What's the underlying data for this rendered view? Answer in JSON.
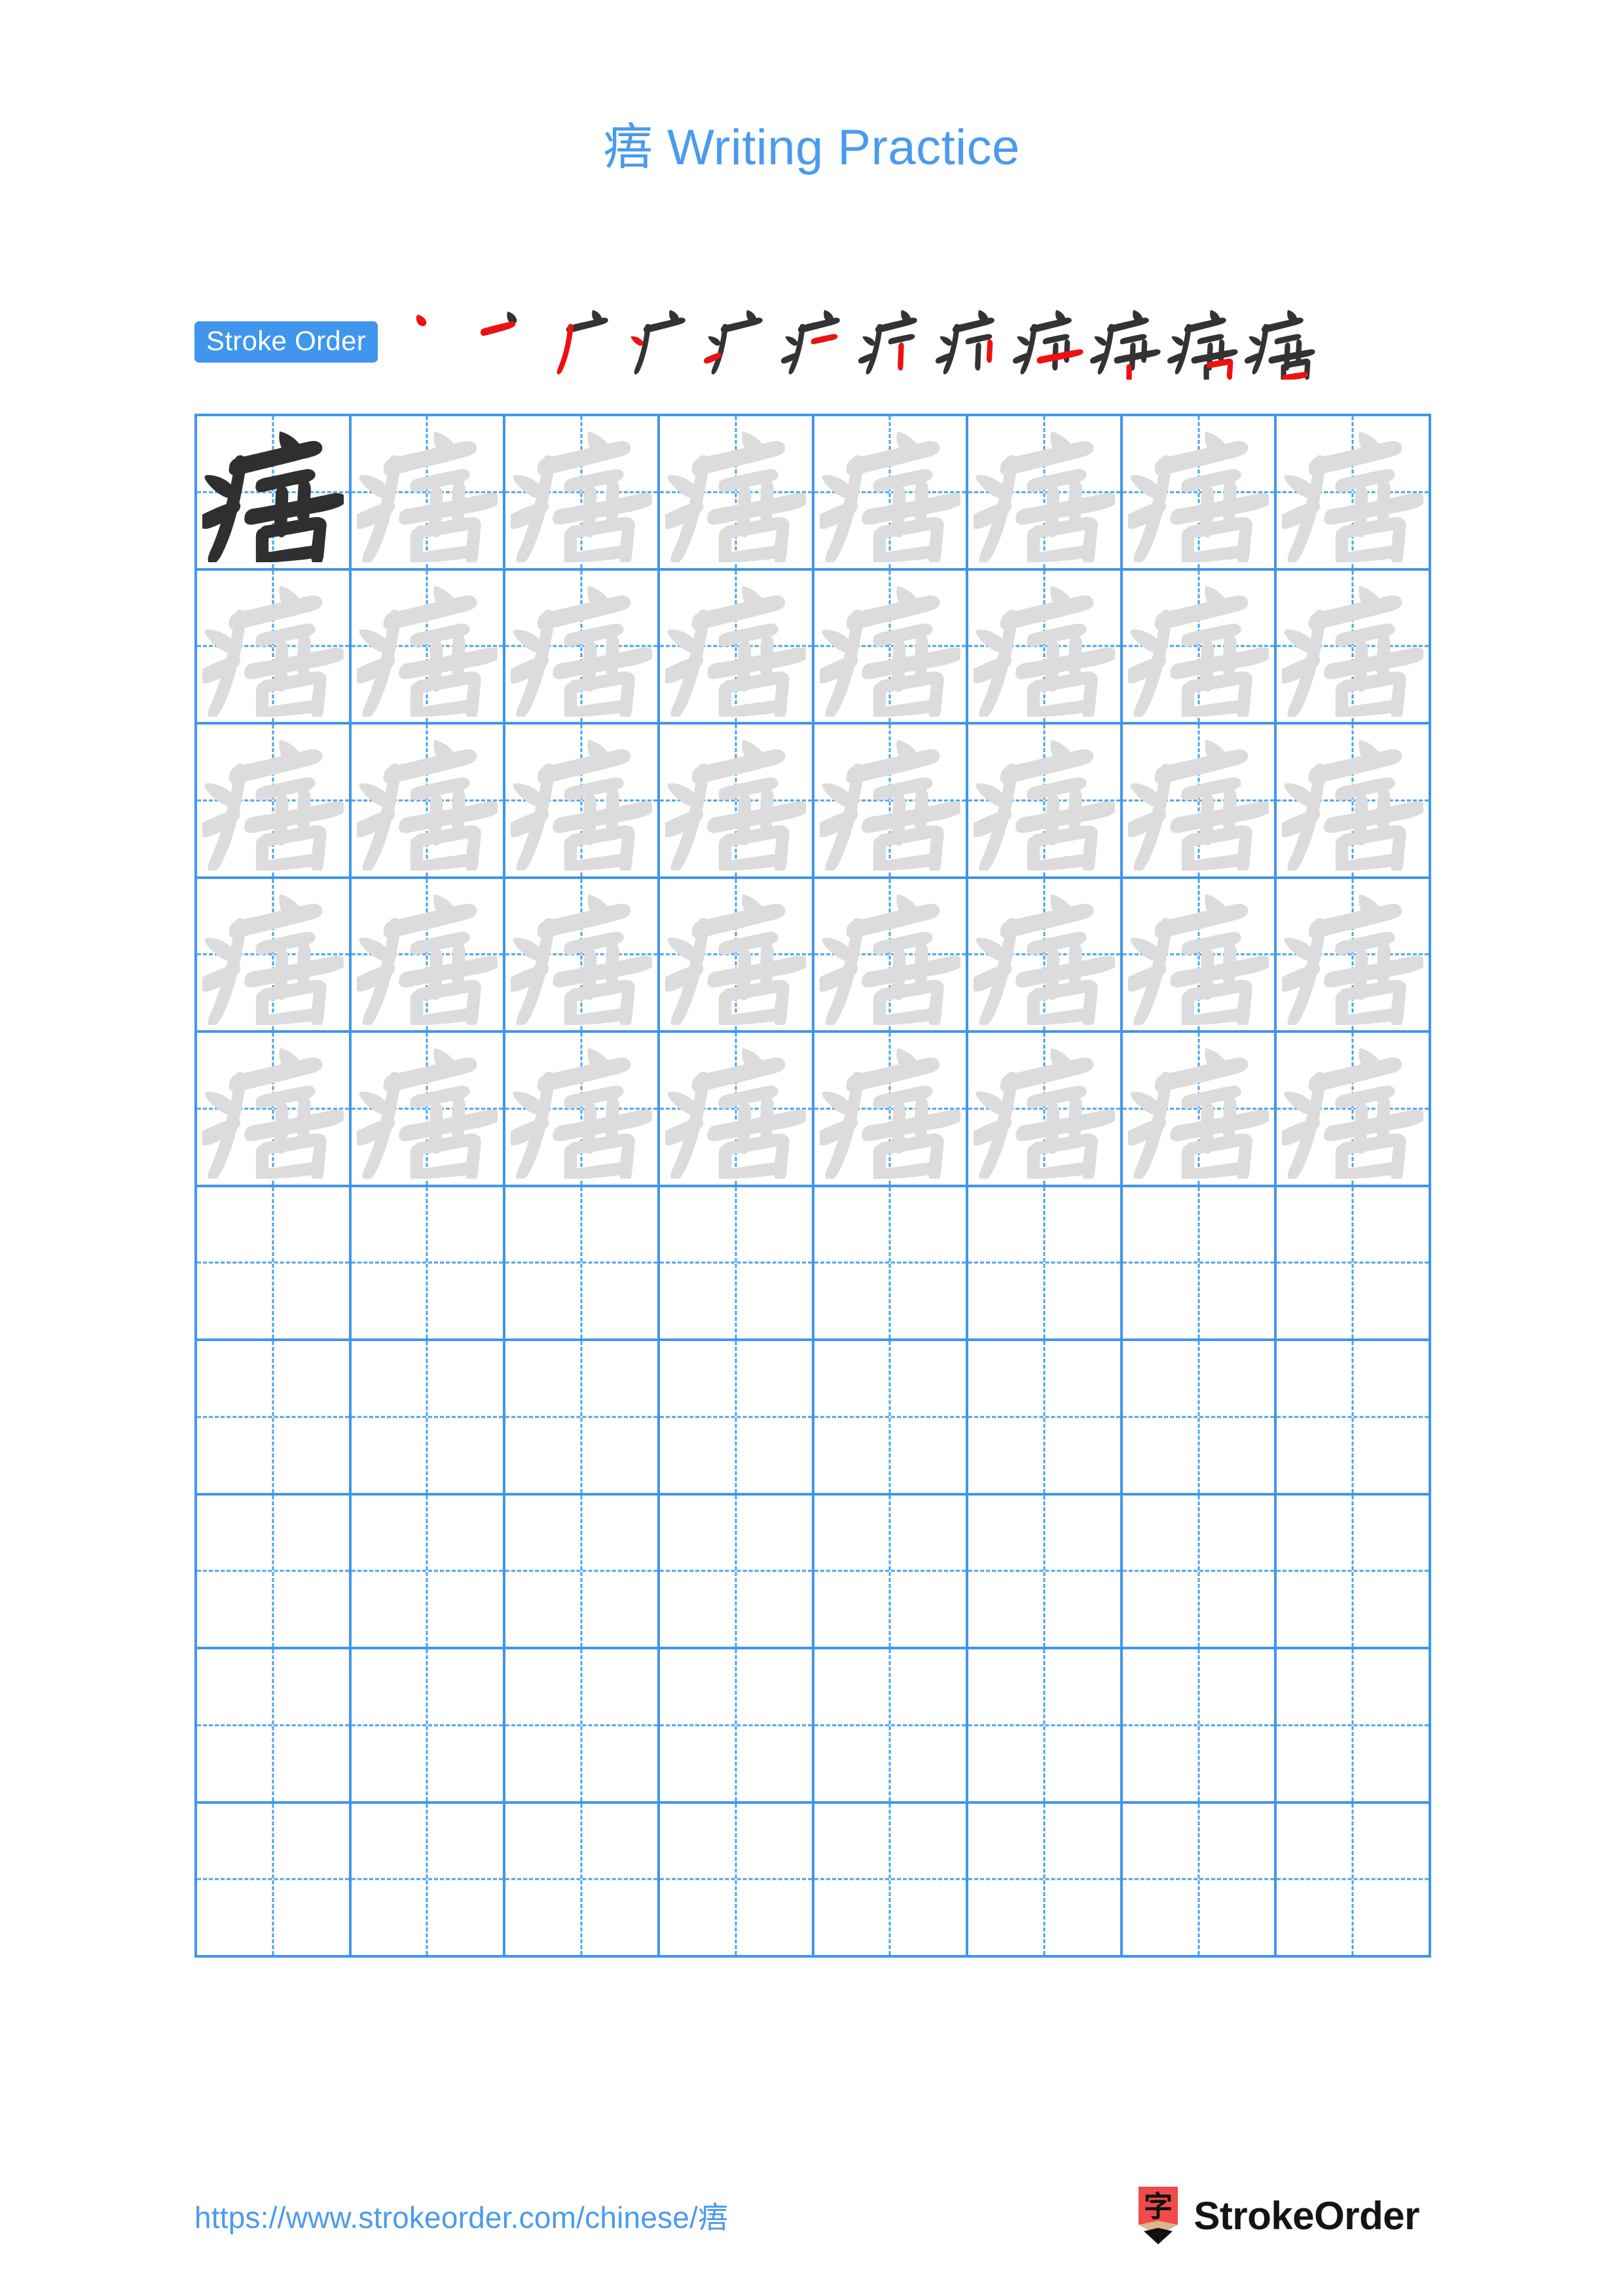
{
  "document": {
    "character": "痦",
    "title": "痦 Writing Practice",
    "page_background": "#ffffff"
  },
  "header": {
    "title": "痦 Writing Practice",
    "title_color": "#4a9bee"
  },
  "stroke_order": {
    "badge_label": "Stroke Order",
    "badge_background": "#3f96ec",
    "badge_text_color": "#ffffff",
    "stroke_count": 12,
    "new_stroke_color": "#ee1111",
    "existing_stroke_color": "#333333",
    "steps": [
      {
        "index": 1,
        "glyph": "丶",
        "description": "dot"
      },
      {
        "index": 2,
        "glyph": "亠",
        "description": "horizontal"
      },
      {
        "index": 3,
        "glyph": "广",
        "description": "left-falling stroke"
      },
      {
        "index": 4,
        "glyph": "广",
        "description": "dot of sickness radical"
      },
      {
        "index": 5,
        "glyph": "疒",
        "description": "left dot"
      },
      {
        "index": 6,
        "glyph": "疒",
        "description": "upper right short stroke"
      },
      {
        "index": 7,
        "glyph": "疒",
        "description": "vertical"
      },
      {
        "index": 8,
        "glyph": "疖",
        "description": "short vertical of 吾"
      },
      {
        "index": 9,
        "glyph": "疘",
        "description": "horizontal of 五"
      },
      {
        "index": 10,
        "glyph": "痦",
        "description": "vertical of mouth"
      },
      {
        "index": 11,
        "glyph": "痦",
        "description": "horizontal-fold of mouth"
      },
      {
        "index": 12,
        "glyph": "痦",
        "description": "closing horizontal"
      }
    ]
  },
  "practice_grid": {
    "columns": 8,
    "rows": 10,
    "border_color": "#3f96ec",
    "guide_color": "#4aa3f0",
    "dark_glyph_color": "#2f2f2f",
    "light_glyph_color": "#dcdcdc",
    "cells": [
      [
        "dark",
        "light",
        "light",
        "light",
        "light",
        "light",
        "light",
        "light"
      ],
      [
        "light",
        "light",
        "light",
        "light",
        "light",
        "light",
        "light",
        "light"
      ],
      [
        "light",
        "light",
        "light",
        "light",
        "light",
        "light",
        "light",
        "light"
      ],
      [
        "light",
        "light",
        "light",
        "light",
        "light",
        "light",
        "light",
        "light"
      ],
      [
        "light",
        "light",
        "light",
        "light",
        "light",
        "light",
        "light",
        "light"
      ],
      [
        "empty",
        "empty",
        "empty",
        "empty",
        "empty",
        "empty",
        "empty",
        "empty"
      ],
      [
        "empty",
        "empty",
        "empty",
        "empty",
        "empty",
        "empty",
        "empty",
        "empty"
      ],
      [
        "empty",
        "empty",
        "empty",
        "empty",
        "empty",
        "empty",
        "empty",
        "empty"
      ],
      [
        "empty",
        "empty",
        "empty",
        "empty",
        "empty",
        "empty",
        "empty",
        "empty"
      ],
      [
        "empty",
        "empty",
        "empty",
        "empty",
        "empty",
        "empty",
        "empty",
        "empty"
      ]
    ]
  },
  "footer": {
    "url": "https://www.strokeorder.com/chinese/痦",
    "url_color": "#4a9bee",
    "brand_name": "StrokeOrder",
    "brand_mark_character": "字",
    "brand_mark_body_color": "#f04a4a",
    "brand_mark_wood_color": "#dbb58d",
    "brand_mark_tip_color": "#111111"
  }
}
